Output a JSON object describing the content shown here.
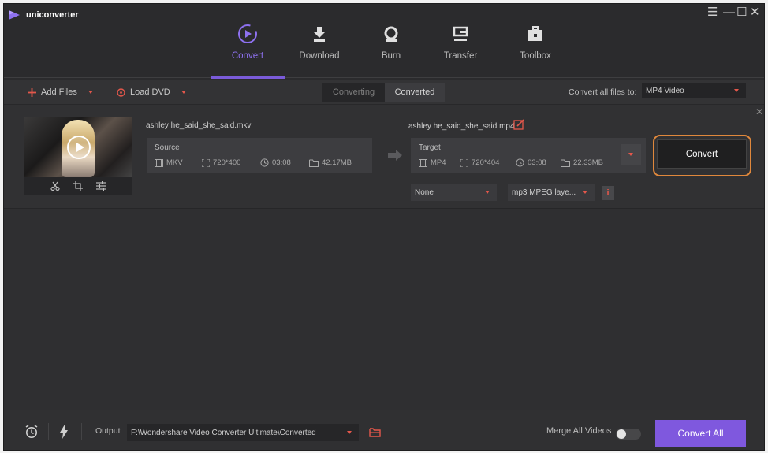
{
  "app": {
    "name": "uniconverter",
    "window_controls": [
      "☰",
      "—",
      "☐",
      "✕"
    ]
  },
  "nav": [
    {
      "label": "Convert",
      "icon": "convert-icon",
      "active": true
    },
    {
      "label": "Download",
      "icon": "download-icon"
    },
    {
      "label": "Burn",
      "icon": "burn-icon"
    },
    {
      "label": "Transfer",
      "icon": "transfer-icon"
    },
    {
      "label": "Toolbox",
      "icon": "toolbox-icon"
    }
  ],
  "toolbar": {
    "add_files": "Add Files",
    "load_dvd": "Load DVD",
    "tab_converting": "Converting",
    "tab_converted": "Converted",
    "convert_all_label": "Convert all files to:",
    "convert_all_value": "MP4 Video"
  },
  "item": {
    "source_name": "ashley he_said_she_said.mkv",
    "target_name": "ashley he_said_she_said.mp4",
    "source": {
      "title": "Source",
      "format": "MKV",
      "resolution": "720*400",
      "duration": "03:08",
      "size": "42.17MB"
    },
    "target": {
      "title": "Target",
      "format": "MP4",
      "resolution": "720*404",
      "duration": "03:08",
      "size": "22.33MB"
    },
    "subtitle_value": "None",
    "audio_value": "mp3 MPEG laye...",
    "convert_label": "Convert",
    "info_label": "i"
  },
  "bottom": {
    "output_label": "Output",
    "output_path": "F:\\Wondershare Video Converter Ultimate\\Converted",
    "merge_label": "Merge All Videos",
    "merge_enabled": false,
    "convert_all_button": "Convert All"
  },
  "colors": {
    "accent": "#7f58de",
    "active_nav": "#8e71f0",
    "red": "#e4574b",
    "highlight_ring": "#e0883c"
  }
}
